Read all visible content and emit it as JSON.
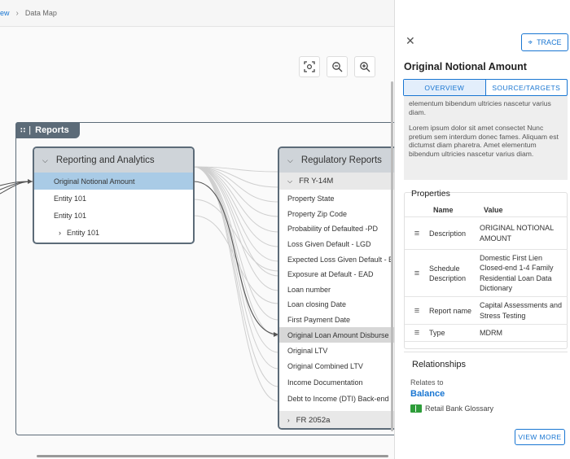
{
  "breadcrumb": {
    "prev": "ew",
    "current": "Data Map"
  },
  "zoom_controls": {
    "fit": "fit-to-screen-icon",
    "zoom_out": "zoom-out-icon",
    "zoom_in": "zoom-in-icon"
  },
  "group": {
    "label": "Reports"
  },
  "source_node": {
    "title": "Reporting and Analytics",
    "rows": [
      "Original Notional Amount",
      "Entity 101",
      "Entity 101"
    ],
    "collapsed": "Entity 101"
  },
  "target_node": {
    "title": "Regulatory Reports",
    "subgroup": "FR Y-14M",
    "rows": [
      "Property State",
      "Property Zip Code",
      "Probability of Defaulted -PD",
      "Loss Given Default - LGD",
      "Expected Loss Given Default - E",
      "Exposure at Default - EAD",
      "Loan number",
      "Loan closing Date",
      "First Payment Date",
      "Original Loan Amount Disburse",
      "Original LTV",
      "Original Combined LTV",
      "Income Documentation",
      "Debt to Income (DTI) Back-end"
    ],
    "collapsed": "FR 2052a"
  },
  "panel": {
    "trace_label": "TRACE",
    "title": "Original Notional Amount",
    "tabs": [
      "OVERVIEW",
      "SOURCE/TARGETS"
    ],
    "desc_top": "elementum bibendum ultricies nascetur varius diam.",
    "desc_para": "Lorem ipsum dolor sit amet consectet Nunc pretium sem interdum donec fames. Aliquam est dictumst diam pharetra. Amet elementum bibendum ultricies nascetur varius diam.",
    "properties_title": "Properties",
    "prop_headers": {
      "name": "Name",
      "value": "Value"
    },
    "properties": [
      {
        "name": "Description",
        "value": "ORIGINAL NOTIONAL AMOUNT"
      },
      {
        "name": "Schedule Description",
        "value": "Domestic First Lien Closed-end 1-4 Family Residential Loan Data Dictionary"
      },
      {
        "name": "Report name",
        "value": "Capital Assessments and Stress Testing"
      },
      {
        "name": "Type",
        "value": "MDRM"
      }
    ],
    "relationships_title": "Relationships",
    "relates_to": "Relates to",
    "relates_link": "Balance",
    "glossary": "Retail Bank Glossary",
    "view_more": "VIEW MORE"
  },
  "colors": {
    "accent": "#1976d2",
    "node_border": "#5c6b78",
    "selected": "#a9cbe6"
  }
}
